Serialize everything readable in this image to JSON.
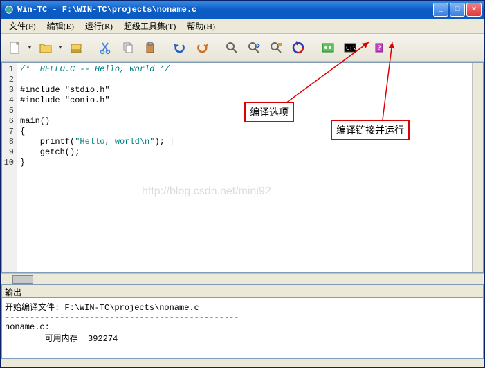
{
  "title": "Win-TC - F:\\WIN-TC\\projects\\noname.c",
  "menu": {
    "file": "文件(F)",
    "edit": "编辑(E)",
    "run": "运行(R)",
    "tools": "超级工具集(T)",
    "help": "帮助(H)"
  },
  "code": {
    "lines": [
      "1",
      "2",
      "3",
      "4",
      "5",
      "6",
      "7",
      "8",
      "9",
      "10"
    ],
    "l1": "/*  HELLO.C -- Hello, world */",
    "l3": "#include \"stdio.h\"",
    "l4": "#include \"conio.h\"",
    "l6": "main()",
    "l7": "{",
    "l8a": "    printf(",
    "l8b": "\"Hello, world\\n\"",
    "l8c": "); ",
    "l9": "    getch();",
    "l10": "}"
  },
  "watermark": "http://blog.csdn.net/mini92",
  "annotations": {
    "a1": "编译选项",
    "a2": "编译链接并运行"
  },
  "output": {
    "header": "输出",
    "line1": "开始编译文件: F:\\WIN-TC\\projects\\noname.c",
    "line2": "-----------------------------------------------",
    "line3": "noname.c:",
    "line4": "        可用内存  392274"
  }
}
